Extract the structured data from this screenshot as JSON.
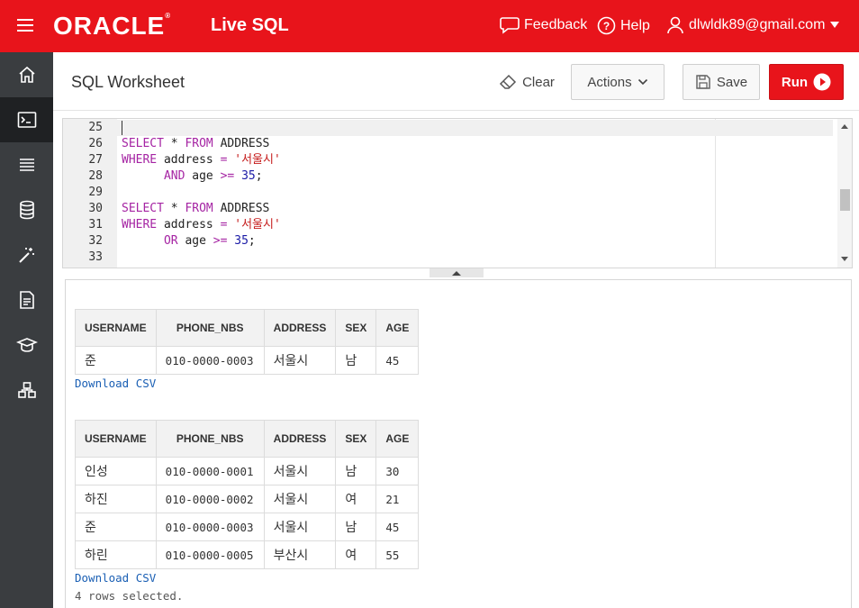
{
  "header": {
    "brand": "ORACLE",
    "product": "Live SQL",
    "feedback_label": "Feedback",
    "help_label": "Help",
    "user_email": "dlwldk89@gmail.com",
    "color": "#e8141b"
  },
  "sidebar": {
    "items": [
      {
        "icon": "home-icon"
      },
      {
        "icon": "terminal-icon",
        "active": true
      },
      {
        "icon": "list-icon"
      },
      {
        "icon": "database-icon"
      },
      {
        "icon": "magic-wand-icon"
      },
      {
        "icon": "document-icon"
      },
      {
        "icon": "graduation-cap-icon"
      },
      {
        "icon": "schema-icon"
      }
    ]
  },
  "toolbar": {
    "title": "SQL Worksheet",
    "clear_label": "Clear",
    "actions_label": "Actions",
    "save_label": "Save",
    "run_label": "Run"
  },
  "editor": {
    "lines": [
      {
        "n": "25",
        "text": ""
      },
      {
        "n": "26",
        "text": "SELECT * FROM ADDRESS"
      },
      {
        "n": "27",
        "text": "WHERE address = '서울시'"
      },
      {
        "n": "28",
        "text": "      AND age >= 35;"
      },
      {
        "n": "29",
        "text": ""
      },
      {
        "n": "30",
        "text": "SELECT * FROM ADDRESS"
      },
      {
        "n": "31",
        "text": "WHERE address = '서울시'"
      },
      {
        "n": "32",
        "text": "      OR age >= 35;"
      },
      {
        "n": "33",
        "text": ""
      }
    ]
  },
  "results": {
    "columns": [
      "USERNAME",
      "PHONE_NBS",
      "ADDRESS",
      "SEX",
      "AGE"
    ],
    "result1": {
      "rows": [
        [
          "준",
          "010-0000-0003",
          "서울시",
          "남",
          "45"
        ]
      ],
      "download_label": "Download CSV"
    },
    "result2": {
      "rows": [
        [
          "인성",
          "010-0000-0001",
          "서울시",
          "남",
          "30"
        ],
        [
          "하진",
          "010-0000-0002",
          "서울시",
          "여",
          "21"
        ],
        [
          "준",
          "010-0000-0003",
          "서울시",
          "남",
          "45"
        ],
        [
          "하린",
          "010-0000-0005",
          "부산시",
          "여",
          "55"
        ]
      ],
      "download_label": "Download CSV",
      "status": "4 rows selected."
    }
  }
}
